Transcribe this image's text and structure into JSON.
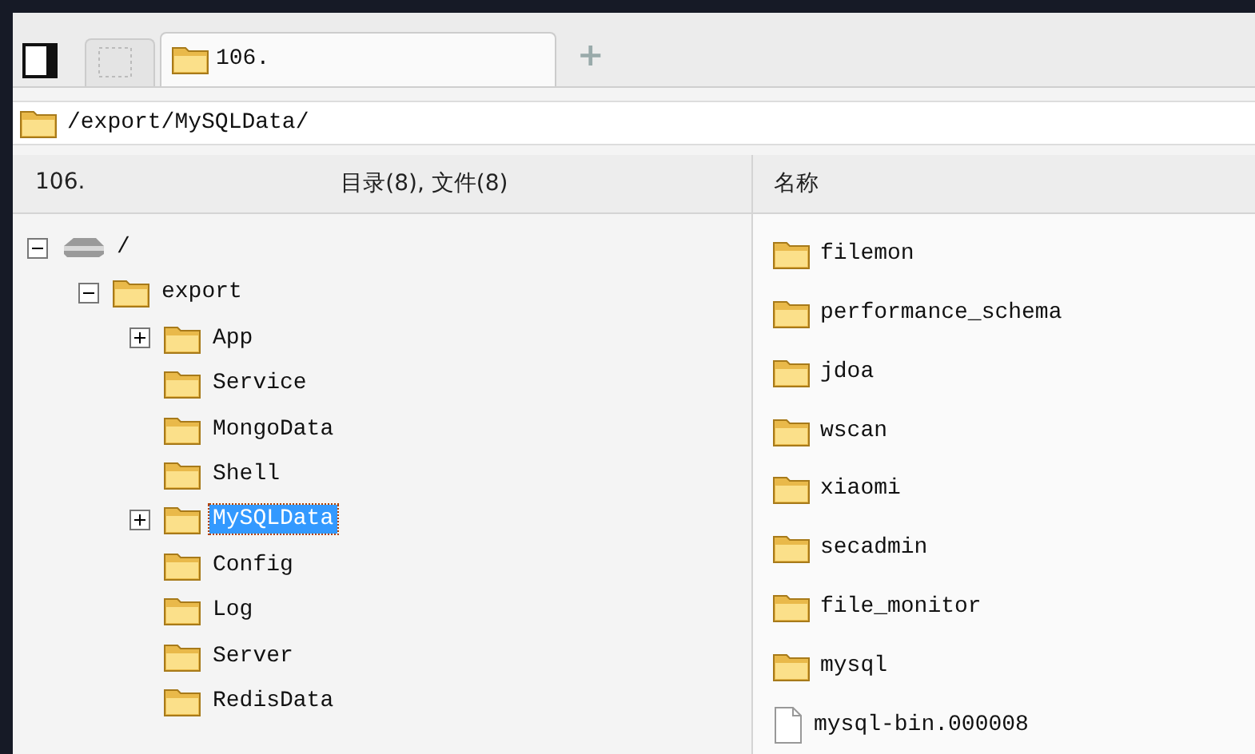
{
  "tabs": [
    {
      "kind": "blank",
      "selected": false
    },
    {
      "kind": "host",
      "label": "106.",
      "selected": true
    }
  ],
  "new_tab": "+",
  "path": "/export/MySQLData/",
  "left_header": {
    "host": "106.",
    "summary": "目录(8), 文件(8)"
  },
  "right_header": {
    "column_1": "名称"
  },
  "tree": [
    {
      "label": "/",
      "kind": "drive",
      "expanded": true,
      "selected": false,
      "children": [
        {
          "label": "export",
          "kind": "folder",
          "expanded": true,
          "selected": false,
          "children": [
            {
              "label": "App",
              "kind": "folder",
              "expanded": false,
              "selected": false
            },
            {
              "label": "Service",
              "kind": "folder",
              "selected": false
            },
            {
              "label": "MongoData",
              "kind": "folder",
              "selected": false
            },
            {
              "label": "Shell",
              "kind": "folder",
              "selected": false
            },
            {
              "label": "MySQLData",
              "kind": "folder",
              "expanded": false,
              "selected": true
            },
            {
              "label": "Config",
              "kind": "folder",
              "selected": false
            },
            {
              "label": "Log",
              "kind": "folder",
              "selected": false
            },
            {
              "label": "Server",
              "kind": "folder",
              "selected": false
            },
            {
              "label": "RedisData",
              "kind": "folder",
              "selected": false
            }
          ]
        }
      ]
    }
  ],
  "files": [
    {
      "name": "filemon",
      "kind": "folder"
    },
    {
      "name": "performance_schema",
      "kind": "folder"
    },
    {
      "name": "jdoa",
      "kind": "folder"
    },
    {
      "name": "wscan",
      "kind": "folder"
    },
    {
      "name": "xiaomi",
      "kind": "folder"
    },
    {
      "name": "secadmin",
      "kind": "folder"
    },
    {
      "name": "file_monitor",
      "kind": "folder"
    },
    {
      "name": "mysql",
      "kind": "folder"
    },
    {
      "name": "mysql-bin.000008",
      "kind": "file"
    }
  ]
}
